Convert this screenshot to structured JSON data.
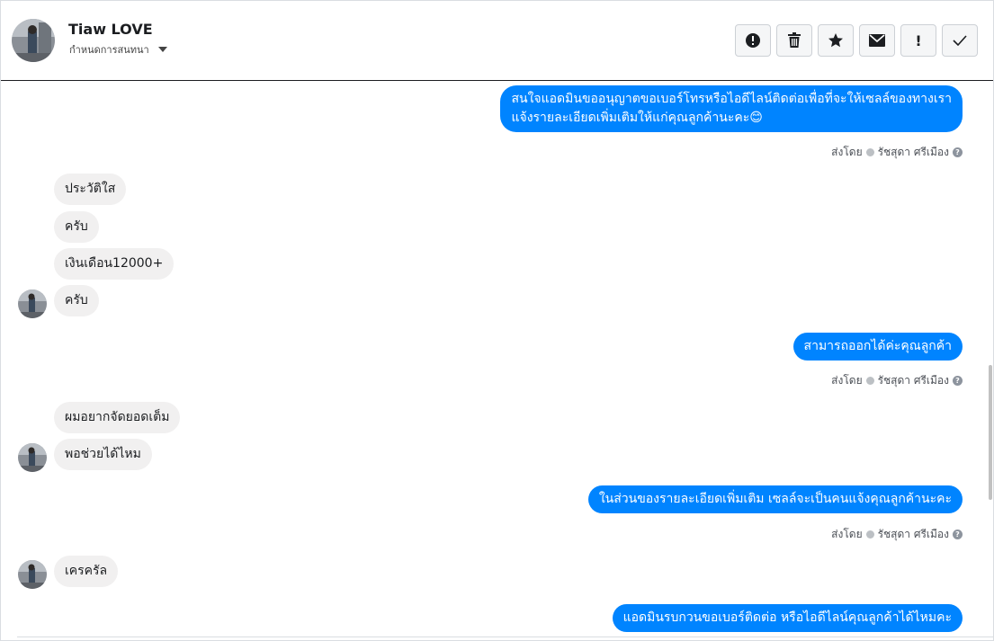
{
  "header": {
    "name": "Tiaw LOVE",
    "subtitle": "กำหนดการสนทนา",
    "actions": [
      {
        "icon": "alert-circle-icon"
      },
      {
        "icon": "trash-icon"
      },
      {
        "icon": "star-icon"
      },
      {
        "icon": "envelope-icon"
      },
      {
        "icon": "exclamation-icon",
        "label": "!"
      },
      {
        "icon": "check-icon"
      }
    ]
  },
  "messages": {
    "out1_line1": "สนใจแอดมินขออนุญาตขอเบอร์โทรหรือไอดีไลน์ติดต่อเพื่อที่จะให้เซลล์ของทางเรา",
    "out1_line2": "แจ้งรายละเอียดเพิ่มเติมให้แก่คุณลูกค้านะคะ😊",
    "in1": "ประวัติใส",
    "in2": "ครับ",
    "in3": "เงินเดือน12000+",
    "in4": "ครับ",
    "out2": "สามารถออกได้ค่ะคุณลูกค้า",
    "in5": "ผมอยากจัดยอดเต็ม",
    "in6": "พอช่วยได้ไหม",
    "out3": "ในส่วนของรายละเอียดเพิ่มเติม  เซลล์จะเป็นคนแจ้งคุณลูกค้านะคะ",
    "in7": "เครครัล",
    "out4": "แอดมินรบกวนขอเบอร์ติดต่อ หรือไอดีไลน์คุณลูกค้าได้ไหมคะ"
  },
  "sent_by": {
    "prefix": "ส่งโดย",
    "agent": "รัชสุดา ศรีเมือง",
    "help": "?"
  },
  "colors": {
    "outgoing_bubble": "#0084ff",
    "incoming_bubble": "#f1f0f0"
  }
}
